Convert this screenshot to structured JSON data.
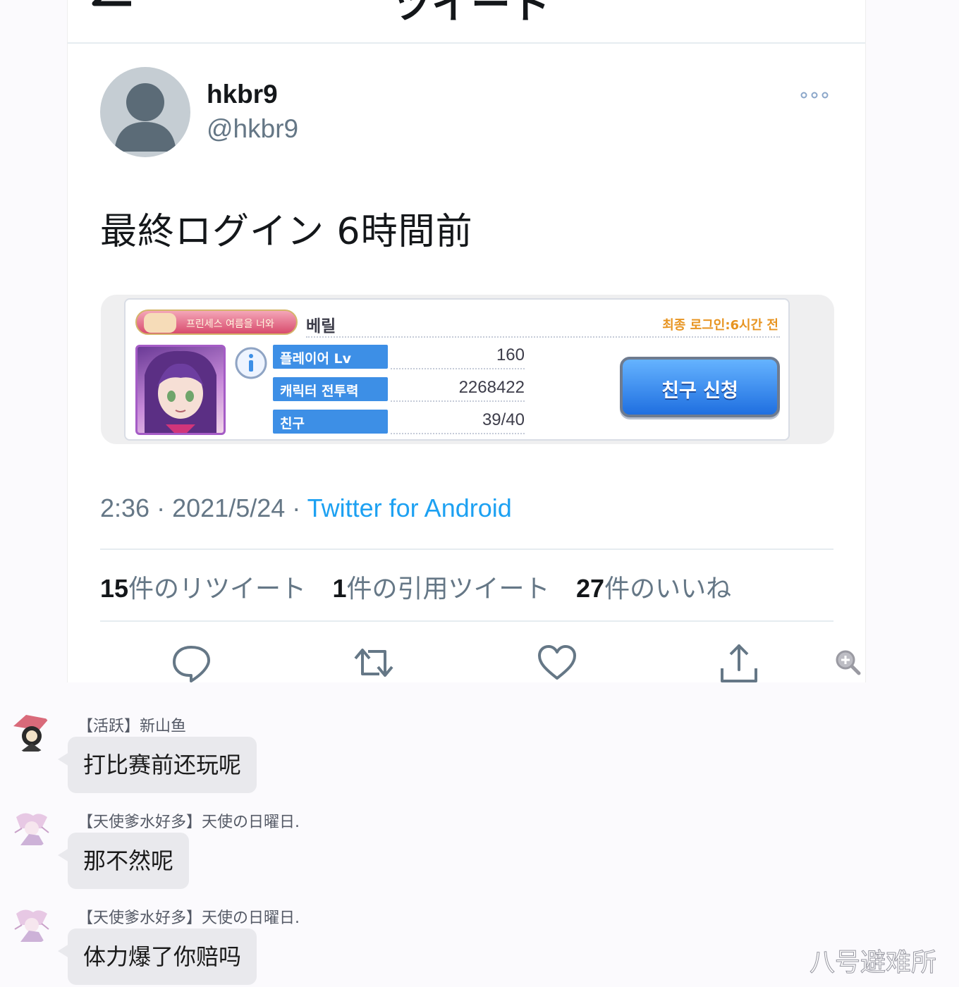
{
  "topbar": {
    "title": "ツイート"
  },
  "tweet": {
    "display_name": "hkbr9",
    "handle": "@hkbr9",
    "text": "最終ログイン 6時間前",
    "time": "2:36",
    "date": "2021/5/24",
    "separator": "·",
    "source": "Twitter for Android",
    "retweets": {
      "count": "15",
      "label": "件のリツイート"
    },
    "quotes": {
      "count": "1",
      "label": "件の引用ツイート"
    },
    "likes": {
      "count": "27",
      "label": "件のいいね"
    }
  },
  "game_card": {
    "banner_text": "프린세스 여름을 너와",
    "player_name": "베릴",
    "last_login": "최종 로그인:6시간 전",
    "stats": [
      {
        "label": "플레이어 Lv",
        "value": "160"
      },
      {
        "label": "캐릭터 전투력",
        "value": "2268422"
      },
      {
        "label": "친구",
        "value": "39/40"
      }
    ],
    "button_label": "친구 신청"
  },
  "actions": [
    "reply-icon",
    "retweet-icon",
    "like-icon",
    "share-icon"
  ],
  "chat": [
    {
      "name": "【活跃】新山鱼",
      "message": "打比赛前还玩呢"
    },
    {
      "name": "【天使爹水好多】天使の日曜日.",
      "message": "那不然呢"
    },
    {
      "name": "【天使爹水好多】天使の日曜日.",
      "message": "体力爆了你赔吗"
    }
  ],
  "watermark": "八号避难所",
  "colors": {
    "link": "#1da1f2",
    "secondary_text": "#657786",
    "game_button": "#1f6fe0",
    "game_label": "#3d8fe6",
    "last_login": "#e79421"
  }
}
